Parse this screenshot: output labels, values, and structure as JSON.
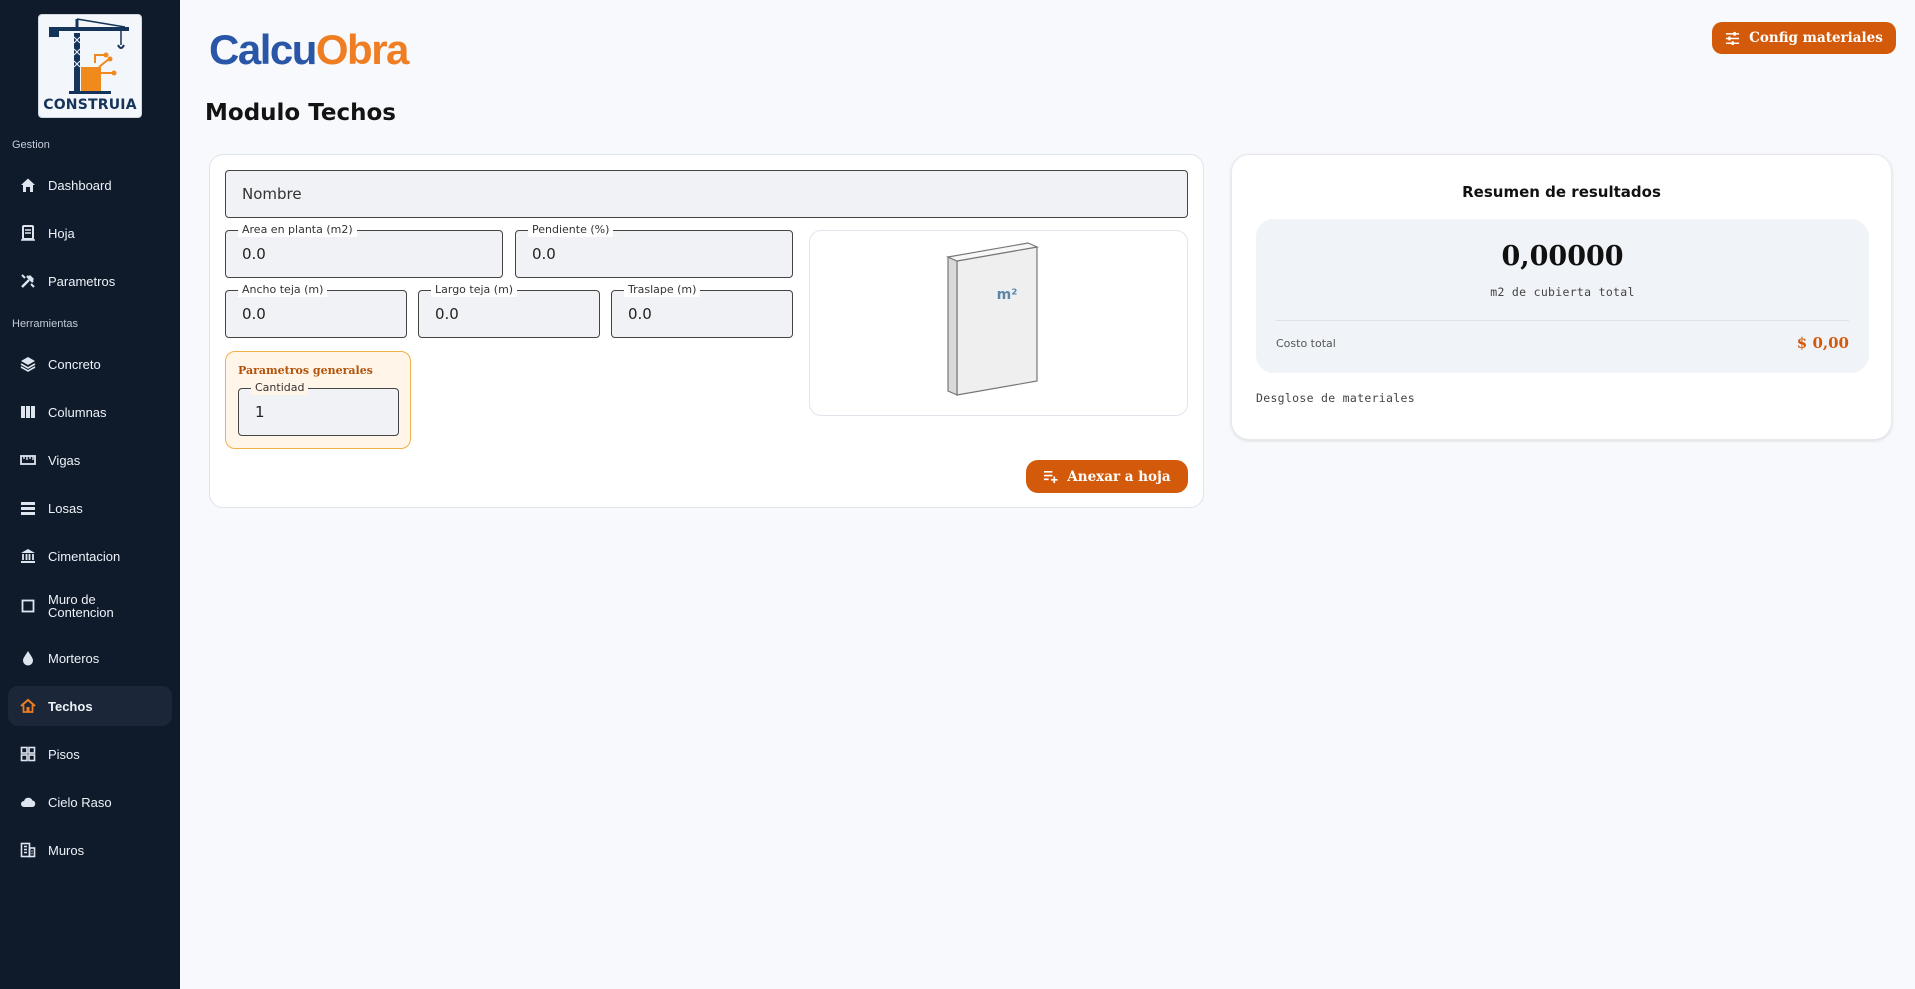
{
  "sidebar": {
    "logo_text": "CONSTRUIA",
    "sections": {
      "gestion": "Gestion",
      "herramientas": "Herramientas"
    },
    "items": [
      {
        "label": "Dashboard",
        "icon": "home-icon"
      },
      {
        "label": "Hoja",
        "icon": "sheet-icon"
      },
      {
        "label": "Parametros",
        "icon": "tools-icon"
      },
      {
        "label": "Concreto",
        "icon": "layers-icon"
      },
      {
        "label": "Columnas",
        "icon": "columns-icon"
      },
      {
        "label": "Vigas",
        "icon": "ruler-icon"
      },
      {
        "label": "Losas",
        "icon": "slabs-icon"
      },
      {
        "label": "Cimentacion",
        "icon": "bank-icon"
      },
      {
        "label": "Muro de Contencion",
        "icon": "square-icon"
      },
      {
        "label": "Morteros",
        "icon": "drop-icon"
      },
      {
        "label": "Techos",
        "icon": "roof-icon",
        "active": true
      },
      {
        "label": "Pisos",
        "icon": "grid-icon"
      },
      {
        "label": "Cielo Raso",
        "icon": "cloud-icon"
      },
      {
        "label": "Muros",
        "icon": "building-icon"
      }
    ]
  },
  "header": {
    "brand_part1": "Calcu",
    "brand_part2": "Obra",
    "config_button": "Config materiales",
    "page_title": "Modulo Techos"
  },
  "form": {
    "nombre_placeholder": "Nombre",
    "area_label": "Area en planta (m2)",
    "area_value": "0.0",
    "pendiente_label": "Pendiente (%)",
    "pendiente_value": "0.0",
    "ancho_label": "Ancho teja (m)",
    "ancho_value": "0.0",
    "largo_label": "Largo teja (m)",
    "largo_value": "0.0",
    "traslape_label": "Traslape (m)",
    "traslape_value": "0.0",
    "params_title": "Parametros generales",
    "cantidad_label": "Cantidad",
    "cantidad_value": "1",
    "illustration_text": "m²",
    "anexar_button": "Anexar a hoja"
  },
  "results": {
    "title": "Resumen de resultados",
    "value": "0,00000",
    "unit": "m2 de cubierta total",
    "cost_label": "Costo total",
    "cost_value": "$ 0,00",
    "breakdown_label": "Desglose de materiales"
  },
  "colors": {
    "sidebar_bg": "#0f1a2b",
    "accent": "#d45a0b",
    "brand_blue": "#2a56a7",
    "brand_orange": "#ef7d22"
  }
}
